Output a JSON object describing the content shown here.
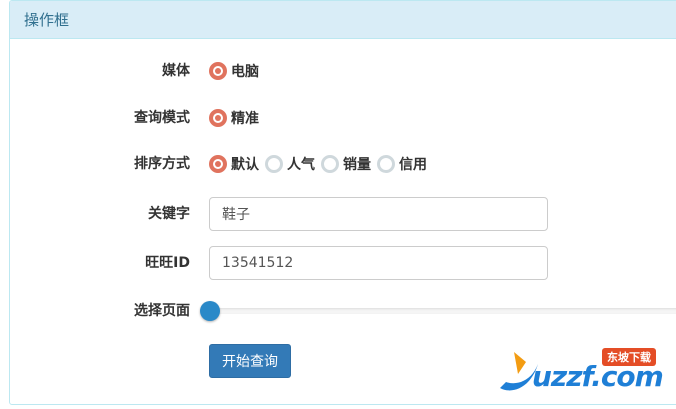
{
  "panel": {
    "title": "操作框"
  },
  "form": {
    "media": {
      "label": "媒体",
      "options": [
        {
          "label": "电脑",
          "checked": true
        }
      ]
    },
    "query_mode": {
      "label": "查询模式",
      "options": [
        {
          "label": "精准",
          "checked": true
        }
      ]
    },
    "sort": {
      "label": "排序方式",
      "options": [
        {
          "label": "默认",
          "checked": true
        },
        {
          "label": "人气",
          "checked": false
        },
        {
          "label": "销量",
          "checked": false
        },
        {
          "label": "信用",
          "checked": false
        }
      ]
    },
    "keyword": {
      "label": "关键字",
      "value": "鞋子"
    },
    "wangwang": {
      "label": "旺旺ID",
      "value": "13541512"
    },
    "page": {
      "label": "选择页面",
      "slider_value": 0
    },
    "submit_label": "开始查询"
  },
  "watermark": {
    "brand": "uzzf.com",
    "badge": "东坡下载"
  },
  "colors": {
    "heading_bg": "#d9edf7",
    "heading_text": "#31708f",
    "radio_checked": "#e0735e",
    "radio_unchecked": "#cfd8dc",
    "primary": "#337ab7",
    "slider_handle": "#2a89c8"
  }
}
